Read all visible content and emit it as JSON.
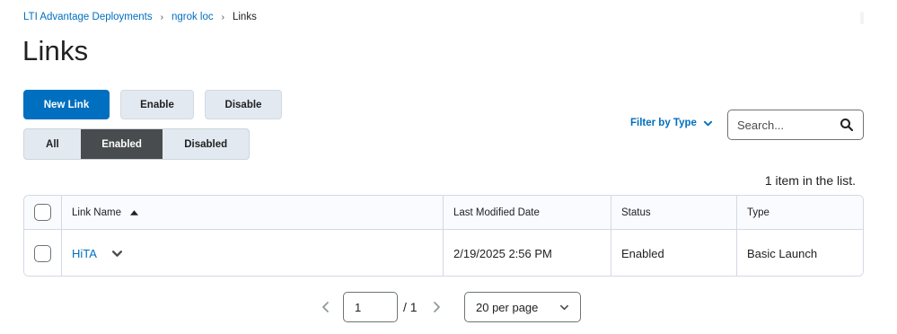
{
  "breadcrumb": {
    "items": [
      "LTI Advantage Deployments",
      "ngrok loc"
    ],
    "current": "Links"
  },
  "page_title": "Links",
  "toolbar": {
    "new_link": "New Link",
    "enable": "Enable",
    "disable": "Disable"
  },
  "status_filter": {
    "options": [
      "All",
      "Enabled",
      "Disabled"
    ],
    "selected": "Enabled"
  },
  "filter_by_type": "Filter by Type",
  "search": {
    "placeholder": "Search...",
    "value": ""
  },
  "item_count": "1 item in the list.",
  "table": {
    "headers": {
      "name": "Link Name",
      "date": "Last Modified Date",
      "status": "Status",
      "type": "Type"
    },
    "sort": {
      "column": "Link Name",
      "direction": "ascending"
    },
    "rows": [
      {
        "name": "HiTA",
        "date": "2/19/2025 2:56 PM",
        "status": "Enabled",
        "type": "Basic Launch"
      }
    ]
  },
  "pagination": {
    "current_page": "1",
    "total_pages": "/ 1",
    "per_page": "20 per page"
  },
  "colors": {
    "primary": "#006fbf",
    "selected_segment": "#494c4e",
    "secondary_button": "#e3e9f1"
  }
}
